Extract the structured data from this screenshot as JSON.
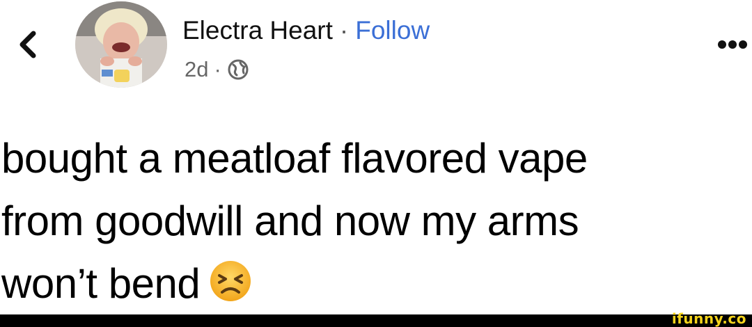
{
  "header": {
    "back_icon": "chevron-left-icon",
    "author_name": "Electra Heart",
    "separator": "·",
    "follow_label": "Follow",
    "timestamp": "2d",
    "meta_separator": "·",
    "audience_icon": "globe-icon",
    "more_icon": "more-dots-icon"
  },
  "post": {
    "lines": [
      "bought a meatloaf flavored vape",
      "from goodwill and now my arms",
      "won’t bend"
    ],
    "emoji": "persevering-face-emoji"
  },
  "footer": {
    "watermark": "ifunny.co"
  },
  "colors": {
    "follow_link": "#3b6fd6",
    "meta_text": "#666666",
    "watermark": "#f5d41c",
    "footer_bar": "#000000"
  }
}
